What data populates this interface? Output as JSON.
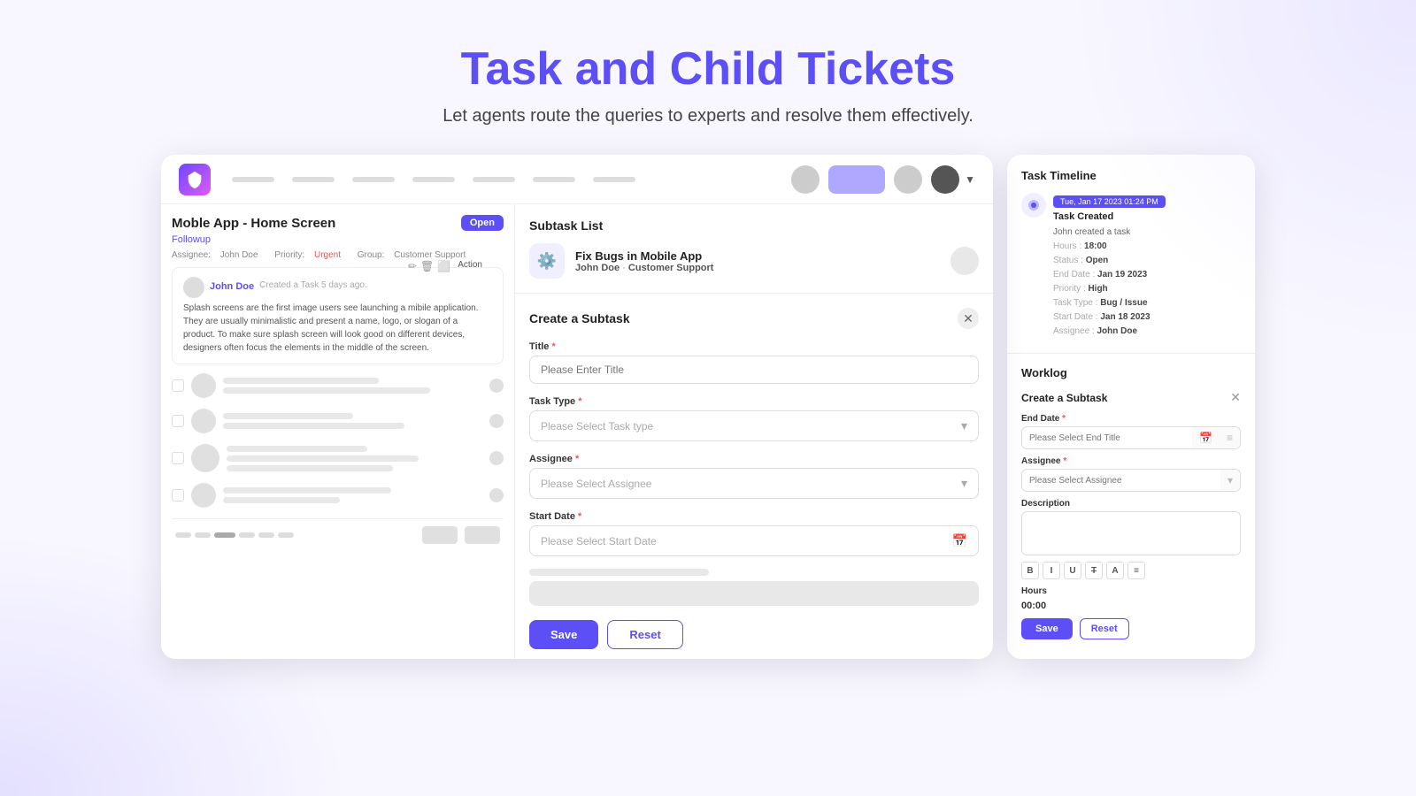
{
  "page": {
    "title": "Task and Child Tickets",
    "subtitle": "Let agents route the queries to experts and resolve them effectively."
  },
  "navbar": {
    "nav_links": [
      "nav1",
      "nav2",
      "nav3",
      "nav4",
      "nav5",
      "nav6",
      "nav7"
    ],
    "actions": [
      "avatar1",
      "avatar-active",
      "avatar2",
      "avatar-dark"
    ]
  },
  "ticket": {
    "title": "Moble App - Home Screen",
    "tag": "Followup",
    "badge": "Open",
    "assignee_label": "Assignee:",
    "assignee": "John Doe",
    "priority_label": "Priority:",
    "priority": "Urgent",
    "group_label": "Group:",
    "group": "Customer Support",
    "action_label": "Action",
    "comment_author": "John Doe",
    "comment_meta": "Created a Task 5 days ago.",
    "comment_text": "Splash screens are the first image users see launching a mibile application. They are usually minimalistic and present a name, logo, or slogan of a product. To make sure splash screen will look good on different devices, designers often focus the elements in the middle of the screen."
  },
  "subtask_list": {
    "title": "Subtask List",
    "item_name": "Fix Bugs in Mobile App",
    "item_sub": "John Doe",
    "item_group": "Customer Support"
  },
  "create_subtask": {
    "title": "Create a Subtask",
    "title_label": "Title",
    "title_placeholder": "Please Enter Title",
    "task_type_label": "Task Type",
    "task_type_placeholder": "Please Select Task type",
    "assignee_label": "Assignee",
    "assignee_placeholder": "Please Select Assignee",
    "start_date_label": "Start Date",
    "start_date_placeholder": "Please Select Start Date",
    "save_label": "Save",
    "reset_label": "Reset"
  },
  "task_timeline": {
    "title": "Task Timeline",
    "date_badge": "Tue, Jan 17 2023  01:24 PM",
    "event_title": "Task Created",
    "event_author": "John created a task",
    "hours_label": "Hours :",
    "hours_val": "18:00",
    "status_label": "Status :",
    "status_val": "Open",
    "end_date_label": "End Date :",
    "end_date_val": "Jan 19 2023",
    "priority_label": "Priority :",
    "priority_val": "High",
    "task_type_label": "Task Type :",
    "task_type_val": "Bug / Issue",
    "start_date_label": "Start Date :",
    "start_date_val": "Jan 18 2023",
    "assignee_label": "Assignee :",
    "assignee_val": "John Doe"
  },
  "worklog": {
    "title": "Worklog",
    "form_title": "Create a Subtask",
    "end_date_label": "End Date",
    "end_date_placeholder": "Please Select End Title",
    "assignee_label": "Assignee",
    "assignee_placeholder": "Please Select Assignee",
    "description_label": "Description",
    "hours_label": "Hours",
    "hours_val": "00:00",
    "save_label": "Save",
    "reset_label": "Reset",
    "toolbar": {
      "bold": "B",
      "italic": "I",
      "underline": "U",
      "strikethrough": "T̶",
      "align": "A",
      "list": "≡"
    }
  }
}
